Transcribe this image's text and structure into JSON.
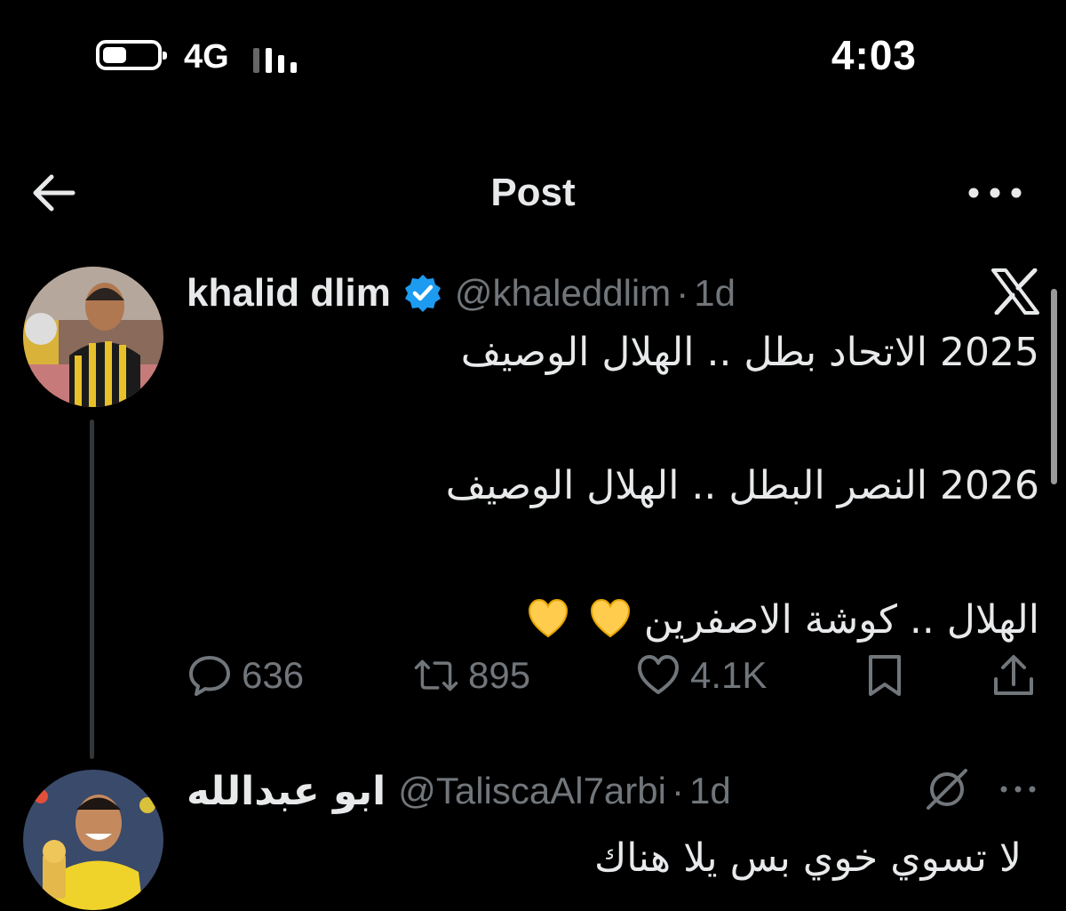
{
  "status_bar": {
    "network": "4G",
    "time": "4:03",
    "battery_level": 0.45
  },
  "nav": {
    "title": "Post",
    "back_icon": "arrow-left-icon",
    "more_icon": "more-horizontal-icon"
  },
  "post": {
    "author_name": "khalid dlim",
    "handle": "@khaleddlim",
    "separator": "·",
    "time": "1d",
    "verified": true,
    "lines": [
      "2025 الاتحاد بطل .. الهلال الوصيف",
      "",
      "2026 النصر البطل .. الهلال الوصيف",
      "",
      "الهلال .. كوشة الاصفرين"
    ],
    "emoji": "yellow-heart-emoji",
    "stats": {
      "replies": "636",
      "reposts": "895",
      "likes": "4.1K"
    }
  },
  "reply": {
    "author_name": "ابو عبدالله",
    "handle": "@TaliscaAl7arbi",
    "separator": "·",
    "time": "1d",
    "text": "لا تسوي خوي بس يلا هناك"
  },
  "colors": {
    "background": "#000000",
    "text": "#e7e9ea",
    "muted": "#71767b",
    "verified_blue": "#1d9bf0",
    "heart_yellow": "#ffcc4d"
  }
}
